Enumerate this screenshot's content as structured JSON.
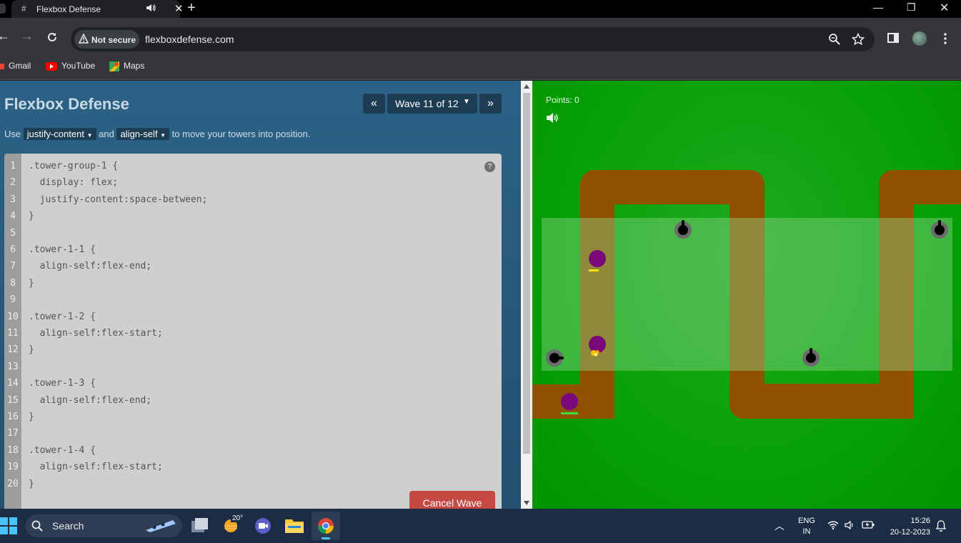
{
  "browser": {
    "tab_title": "Flexbox Defense",
    "tab_favicon": "#",
    "not_secure": "Not secure",
    "url": "flexboxdefense.com",
    "bookmarks": [
      {
        "label": "Gmail",
        "icon": "gmail-icon"
      },
      {
        "label": "YouTube",
        "icon": "youtube-icon"
      },
      {
        "label": "Maps",
        "icon": "maps-icon"
      }
    ]
  },
  "game": {
    "title": "Flexbox Defense",
    "wave_label": "Wave 11 of 12",
    "prev_label": "«",
    "next_label": "»",
    "instruction": {
      "use": "Use",
      "prop1": "justify-content",
      "and": "and",
      "prop2": "align-self",
      "rest": "to move your towers into position."
    },
    "code_lines": [
      ".tower-group-1 {",
      "  display: flex;",
      "  justify-content:space-between;",
      "}",
      "",
      ".tower-1-1 {",
      "  align-self:flex-end;",
      "}",
      "",
      ".tower-1-2 {",
      "  align-self:flex-start;",
      "}",
      "",
      ".tower-1-3 {",
      "  align-self:flex-end;",
      "}",
      "",
      ".tower-1-4 {",
      "  align-self:flex-start;",
      "}"
    ],
    "help_label": "?",
    "cancel_label": "Cancel Wave",
    "points_label": "Points: 0",
    "colors": {
      "panel_bg": "#2c6286",
      "path": "#8f5200",
      "grass": "#07a007",
      "enemy": "#7a0a7a",
      "cancel_button": "#c44a43"
    }
  },
  "taskbar": {
    "search_label": "Search",
    "weather_temp": "20°",
    "lang": "ENG",
    "region": "IN",
    "time": "15:26",
    "date": "20-12-2023"
  }
}
